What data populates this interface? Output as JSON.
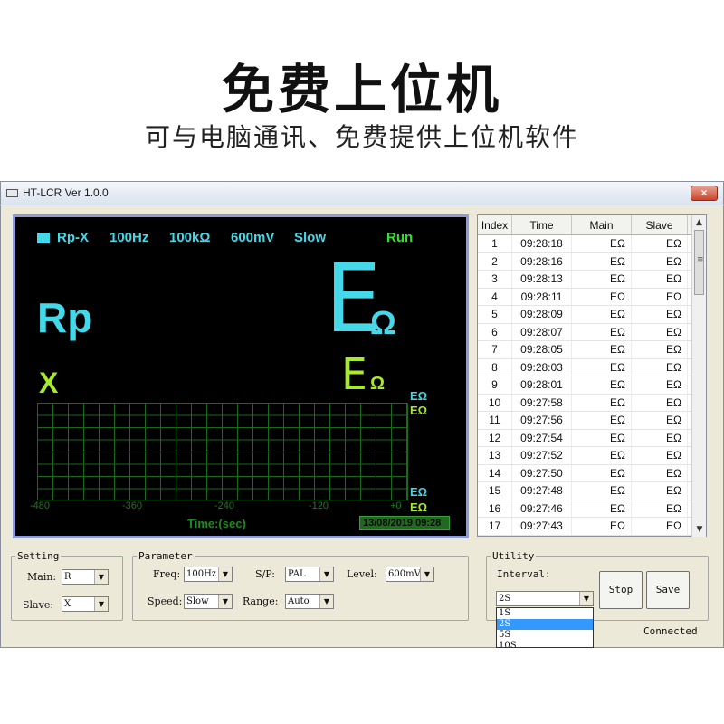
{
  "banner": {
    "headline": "免费上位机",
    "subline": "可与电脑通讯、免费提供上位机软件"
  },
  "window": {
    "title": "HT-LCR Ver 1.0.0",
    "close_glyph": "×"
  },
  "display": {
    "mode": "Rp-X",
    "frequency": "100Hz",
    "range": "100kΩ",
    "level": "600mV",
    "speed": "Slow",
    "state": "Run",
    "main_param": "Rp",
    "main_value": "E",
    "main_unit": "Ω",
    "slave_param": "X",
    "slave_value": "E",
    "slave_unit": "Ω",
    "right_labels": [
      "EΩ",
      "EΩ",
      "EΩ",
      "EΩ"
    ],
    "axis_ticks": [
      "-480",
      "-360",
      "-240",
      "-120",
      "+0"
    ],
    "axis_label": "Time:(sec)",
    "timestamp": "13/08/2019  09:28",
    "colors": {
      "cyan": "#44d8e8",
      "green": "#a8e830",
      "grid": "#1a6a1a",
      "frame": "#8d9bd6"
    }
  },
  "table": {
    "headers": [
      "Index",
      "Time",
      "Main",
      "Slave"
    ],
    "rows": [
      [
        "1",
        "09:28:18",
        "EΩ",
        "EΩ"
      ],
      [
        "2",
        "09:28:16",
        "EΩ",
        "EΩ"
      ],
      [
        "3",
        "09:28:13",
        "EΩ",
        "EΩ"
      ],
      [
        "4",
        "09:28:11",
        "EΩ",
        "EΩ"
      ],
      [
        "5",
        "09:28:09",
        "EΩ",
        "EΩ"
      ],
      [
        "6",
        "09:28:07",
        "EΩ",
        "EΩ"
      ],
      [
        "7",
        "09:28:05",
        "EΩ",
        "EΩ"
      ],
      [
        "8",
        "09:28:03",
        "EΩ",
        "EΩ"
      ],
      [
        "9",
        "09:28:01",
        "EΩ",
        "EΩ"
      ],
      [
        "10",
        "09:27:58",
        "EΩ",
        "EΩ"
      ],
      [
        "11",
        "09:27:56",
        "EΩ",
        "EΩ"
      ],
      [
        "12",
        "09:27:54",
        "EΩ",
        "EΩ"
      ],
      [
        "13",
        "09:27:52",
        "EΩ",
        "EΩ"
      ],
      [
        "14",
        "09:27:50",
        "EΩ",
        "EΩ"
      ],
      [
        "15",
        "09:27:48",
        "EΩ",
        "EΩ"
      ],
      [
        "16",
        "09:27:46",
        "EΩ",
        "EΩ"
      ],
      [
        "17",
        "09:27:43",
        "EΩ",
        "EΩ"
      ]
    ]
  },
  "setting": {
    "legend": "Setting",
    "main_label": "Main:",
    "main_value": "R",
    "slave_label": "Slave:",
    "slave_value": "X"
  },
  "parameter": {
    "legend": "Parameter",
    "freq_label": "Freq:",
    "freq_value": "100Hz",
    "sp_label": "S/P:",
    "sp_value": "PAL",
    "level_label": "Level:",
    "level_value": "600mV",
    "speed_label": "Speed:",
    "speed_value": "Slow",
    "range_label": "Range:",
    "range_value": "Auto"
  },
  "utility": {
    "legend": "Utility",
    "interval_label": "Interval:",
    "interval_value": "2S",
    "interval_options": [
      "1S",
      "2S",
      "5S",
      "10S"
    ],
    "stop_label": "Stop",
    "save_label": "Save",
    "status": "Connected"
  }
}
